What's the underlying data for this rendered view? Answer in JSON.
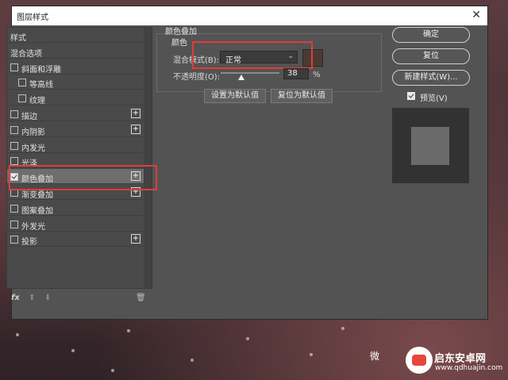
{
  "dialog": {
    "title": "图层样式",
    "close_glyph": "✕"
  },
  "styles_list": [
    {
      "label": "样式",
      "checkbox": false,
      "checked": false,
      "plus": false,
      "indent": 0
    },
    {
      "label": "混合选项",
      "checkbox": false,
      "checked": false,
      "plus": false,
      "indent": 0
    },
    {
      "label": "斜面和浮雕",
      "checkbox": true,
      "checked": false,
      "plus": false,
      "indent": 0
    },
    {
      "label": "等高线",
      "checkbox": true,
      "checked": false,
      "plus": false,
      "indent": 1
    },
    {
      "label": "纹理",
      "checkbox": true,
      "checked": false,
      "plus": false,
      "indent": 1
    },
    {
      "label": "描边",
      "checkbox": true,
      "checked": false,
      "plus": true,
      "indent": 0
    },
    {
      "label": "内阴影",
      "checkbox": true,
      "checked": false,
      "plus": true,
      "indent": 0
    },
    {
      "label": "内发光",
      "checkbox": true,
      "checked": false,
      "plus": false,
      "indent": 0
    },
    {
      "label": "光泽",
      "checkbox": true,
      "checked": false,
      "plus": false,
      "indent": 0
    },
    {
      "label": "颜色叠加",
      "checkbox": true,
      "checked": true,
      "plus": true,
      "indent": 0,
      "selected": true
    },
    {
      "label": "渐变叠加",
      "checkbox": true,
      "checked": false,
      "plus": true,
      "indent": 0
    },
    {
      "label": "图案叠加",
      "checkbox": true,
      "checked": false,
      "plus": false,
      "indent": 0
    },
    {
      "label": "外发光",
      "checkbox": true,
      "checked": false,
      "plus": false,
      "indent": 0
    },
    {
      "label": "投影",
      "checkbox": true,
      "checked": false,
      "plus": true,
      "indent": 0
    }
  ],
  "fx_bar": {
    "fx": "fx",
    "up": "⬆",
    "down": "⬇",
    "trash": "🗑"
  },
  "color_overlay": {
    "group_title": "颜色叠加",
    "sub_title": "颜色",
    "blend_mode_label": "混合模式(B):",
    "blend_mode_value": "正常",
    "swatch_color": "#4a3a32",
    "opacity_label": "不透明度(O):",
    "opacity_value": "38",
    "opacity_unit": "%",
    "make_default": "设置为默认值",
    "reset_default": "复位为默认值"
  },
  "right_buttons": {
    "ok": "确定",
    "reset": "复位",
    "new_style": "新建样式(W)...",
    "preview_label": "预览(V)",
    "preview_checked": true
  },
  "watermark": {
    "wechat_prefix": "微",
    "name": "启东安卓网",
    "url": "www.qdhuajin.com"
  },
  "colors": {
    "highlight": "#e33a3a",
    "dialog_bg": "#535353"
  }
}
